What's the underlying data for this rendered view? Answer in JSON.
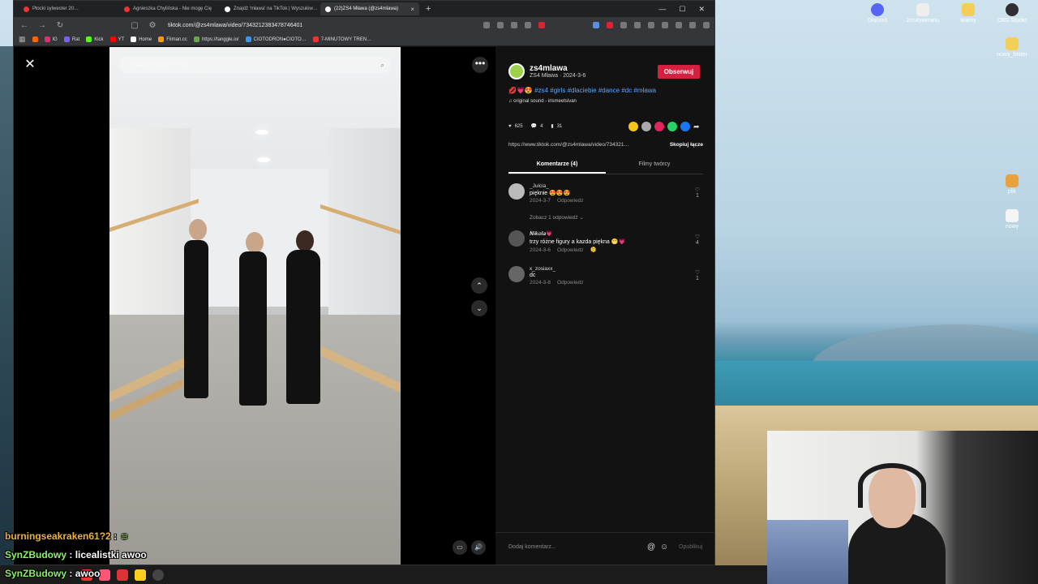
{
  "browser": {
    "tabs": [
      {
        "label": "Płocki sylwester 20…",
        "color": "#e33"
      },
      {
        "label": "Agnieszka Chylińska - Nie mogę Cię",
        "color": "#e33"
      },
      {
        "label": "Znajdź 'mława' na TikTok | Wyszukiw…",
        "color": "#fff"
      },
      {
        "label": "(22)ZS4 Mława (@zs4mlawa)",
        "color": "#fff"
      }
    ],
    "tab_close": "×",
    "new_tab": "+",
    "url": "tiktok.com/@zs4mlawa/video/7343212383478746401",
    "bookmarks": [
      {
        "label": "IG",
        "color": "#e1306c"
      },
      {
        "label": "Rat",
        "color": "#7b5cff"
      },
      {
        "label": "Kick",
        "color": "#53fc18"
      },
      {
        "label": "YT",
        "color": "#f00"
      },
      {
        "label": "Home",
        "color": "#fff"
      },
      {
        "label": "Filman.cc",
        "color": "#f90"
      },
      {
        "label": "https://tanggle.io/",
        "color": "#6a4"
      },
      {
        "label": "CIOTODRON●CIOTO…",
        "color": "#39f"
      },
      {
        "label": "7-MINUTOWY TREN…",
        "color": "#e33"
      }
    ]
  },
  "video": {
    "search_placeholder": "Znajdź powiązane treści",
    "close": "✕",
    "more": "•••",
    "up": "⌃",
    "down": "⌄"
  },
  "post": {
    "author": "zs4mlawa",
    "meta": "ZS4 Mława · 2024-3-6",
    "follow": "Obserwuj",
    "desc": "#zs4 #girls #dlaciebie #dance #dc #mława",
    "sound": "original sound - irismeetsivan",
    "likes": "625",
    "comments_count": "4",
    "saves": "31",
    "link": "https://www.tiktok.com/@zs4mlawa/video/734321…",
    "copy": "Skopiuj łącze",
    "tab_comments": "Komentarze (4)",
    "tab_creator": "Filmy twórcy",
    "share_colors": [
      "#f5c518",
      "#aaa",
      "#e0245e",
      "#25d366",
      "#1877f2"
    ]
  },
  "comments": [
    {
      "user": "_Julcia_",
      "text": "pięknie 😍😍😍",
      "date": "2024-3-7",
      "reply": "Odpowiedz",
      "likes": "1",
      "replies": "Zobacz 1 odpowiedź ⌄"
    },
    {
      "user": "𝑵𝒊𝒌𝒐𝒍𝒂💗",
      "text": "trzy różne figury a kazda piękna 😁💗",
      "date": "2024-3-6",
      "reply": "Odpowiedz",
      "likes": "4"
    },
    {
      "user": "x_zosiaxx_",
      "text": "dc",
      "date": "2024-3-8",
      "reply": "Odpowiedz",
      "likes": "1"
    }
  ],
  "add_comment": {
    "placeholder": "Dodaj komentarz...",
    "post": "Opublikuj"
  },
  "chat": [
    {
      "user": "burningseakraken61?2",
      "msg": ""
    },
    {
      "user": "SynZBudowy",
      "msg": "licealistki awoo"
    },
    {
      "user": "SynZBudowy",
      "msg": "awoo"
    }
  ],
  "desktop_icons": [
    "Discord",
    "zrzutyekranu",
    "teamy",
    "OBS Studio",
    "nowy_folder",
    "plik",
    "nowy"
  ]
}
